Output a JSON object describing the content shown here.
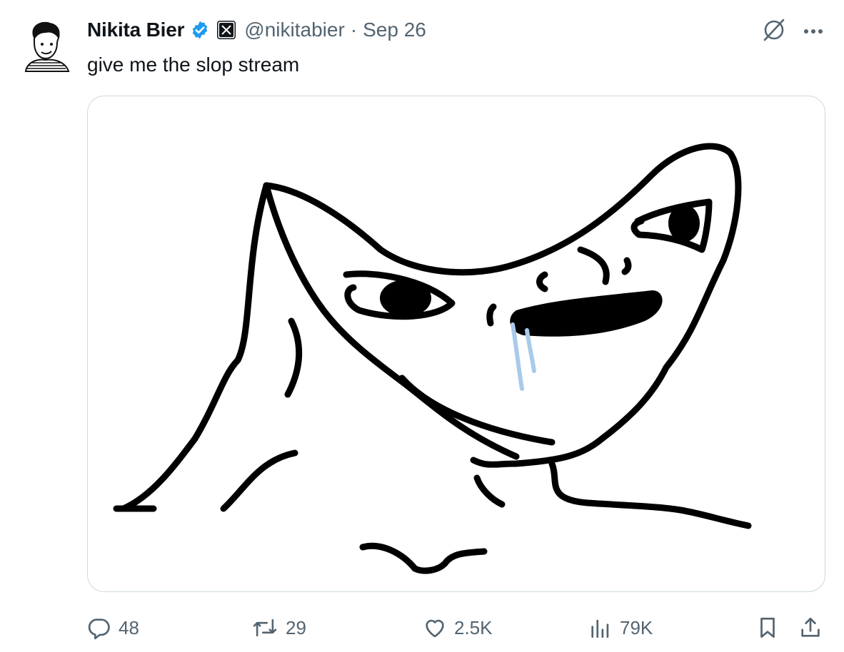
{
  "post": {
    "author_name": "Nikita Bier",
    "handle": "@nikitabier",
    "separator": "·",
    "date": "Sep 26",
    "text": "give me the slop stream"
  },
  "icons": {
    "verified": "verified-badge-icon",
    "affiliate": "x-logo-icon",
    "grok": "grok-icon",
    "more": "more-icon",
    "reply": "reply-icon",
    "repost": "repost-icon",
    "like": "like-icon",
    "views": "views-icon",
    "bookmark": "bookmark-icon",
    "share": "share-icon"
  },
  "metrics": {
    "replies": "48",
    "reposts": "29",
    "likes": "2.5K",
    "views": "79K"
  },
  "colors": {
    "text": "#0f1419",
    "secondary": "#536471",
    "verified": "#1d9bf0",
    "border": "#cfd9de"
  }
}
